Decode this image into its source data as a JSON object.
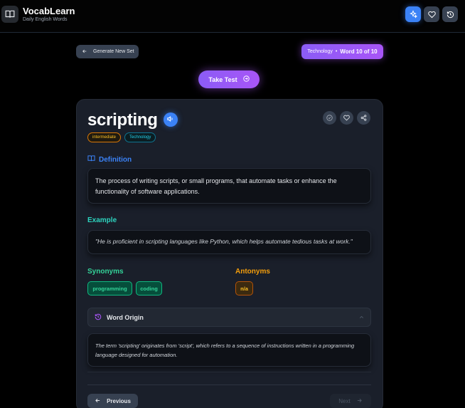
{
  "header": {
    "app_title": "VocabLearn",
    "app_subtitle": "Daily English Words",
    "logo_icon": "book-open-icon",
    "icons": [
      "sparkles-icon",
      "heart-icon",
      "history-icon"
    ]
  },
  "toolbar": {
    "generate_label": "Generate New Set",
    "topic_label": "Technology",
    "separator": "•",
    "progress_label": "Word 10 of 10",
    "take_test_label": "Take Test"
  },
  "word": {
    "text": "scripting",
    "level_tag": "intermediate",
    "topic_tag": "Technology"
  },
  "definition": {
    "title": "Definition",
    "text": "The process of writing scripts, or small programs, that automate tasks or enhance the functionality of software applications."
  },
  "example": {
    "title": "Example",
    "text": "\"He is proficient in scripting languages like Python, which helps automate tedious tasks at work.\""
  },
  "synonyms": {
    "title": "Synonyms",
    "items": [
      "programming",
      "coding"
    ]
  },
  "antonyms": {
    "title": "Antonyms",
    "items": [
      "n/a"
    ]
  },
  "origin": {
    "title": "Word Origin",
    "text": "The term 'scripting' originates from 'script', which refers to a sequence of instructions written in a programming language designed for automation."
  },
  "navigation": {
    "previous_label": "Previous",
    "next_label": "Next"
  },
  "colors": {
    "accent_blue": "#3b82f6",
    "accent_purple": "#a855f7",
    "teal": "#2dd4bf",
    "green": "#34d399",
    "amber": "#f59e0b"
  }
}
